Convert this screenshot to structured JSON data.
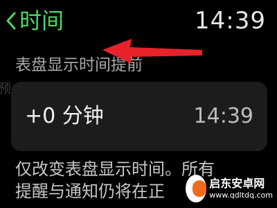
{
  "header": {
    "back_title": "时间",
    "clock": "14:39",
    "back_icon": "chevron-left-icon"
  },
  "section": {
    "header": "表盘显示时间提前",
    "side_glyph": "预"
  },
  "offset_row": {
    "value": "+0 分钟",
    "time": "14:39"
  },
  "description": "仅改变表盘显示时间。所有\n提醒与通知仍将在正",
  "annotation": {
    "arrow_color": "#e8222b",
    "icon": "arrow-left-icon"
  },
  "watermark": {
    "name": "启东安卓网",
    "url": "www.qdltdq.com"
  },
  "colors": {
    "accent": "#4cd964",
    "background": "#000000",
    "row_background": "#1c1c1e"
  }
}
